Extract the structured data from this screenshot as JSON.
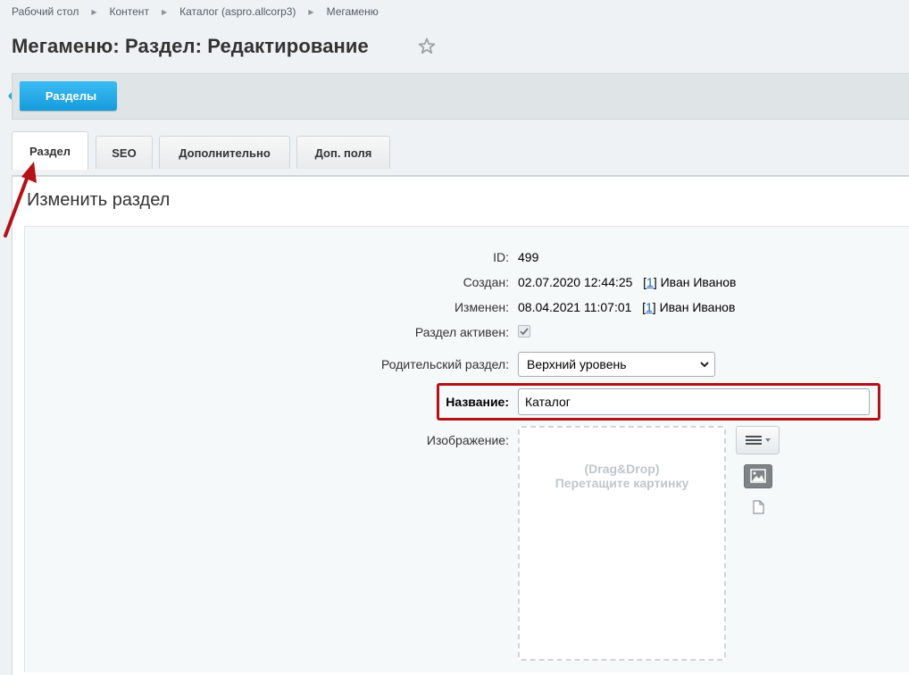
{
  "breadcrumb": [
    "Рабочий стол",
    "Контент",
    "Каталог (aspro.allcorp3)",
    "Мегаменю"
  ],
  "page_title": "Мегаменю: Раздел: Редактирование",
  "toolbar": {
    "sections_button": "Разделы"
  },
  "tabs": [
    {
      "label": "Раздел",
      "active": true
    },
    {
      "label": "SEO",
      "active": false
    },
    {
      "label": "Дополнительно",
      "active": false
    },
    {
      "label": "Доп. поля",
      "active": false
    }
  ],
  "panel_title": "Изменить раздел",
  "form": {
    "id_label": "ID:",
    "id_value": "499",
    "created_label": "Создан:",
    "created_date": "02.07.2020 12:44:25",
    "created_user_id": "1",
    "created_user_name": "Иван Иванов",
    "modified_label": "Изменен:",
    "modified_date": "08.04.2021 11:07:01",
    "modified_user_id": "1",
    "modified_user_name": "Иван Иванов",
    "active_label": "Раздел активен:",
    "active_checked": true,
    "parent_label": "Родительский раздел:",
    "parent_value": "Верхний уровень",
    "name_label": "Название:",
    "name_value": "Каталог",
    "image_label": "Изображение:",
    "dropzone_line1": "(Drag&Drop)",
    "dropzone_line2": "Перетащите картинку"
  },
  "colors": {
    "accent_blue": "#169bdb",
    "highlight_red": "#b31219",
    "link_blue": "#2067b0"
  },
  "icons": [
    "star-icon",
    "menu-lines-icon",
    "image-icon",
    "file-icon",
    "checkmark-icon",
    "chevron-down-icon",
    "annotation-arrow"
  ]
}
